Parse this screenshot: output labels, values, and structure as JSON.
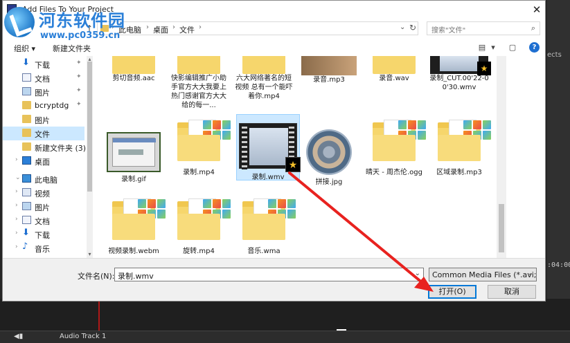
{
  "window": {
    "title": "Add Files To Your Project",
    "close_glyph": "✕"
  },
  "watermark": {
    "title": "河东软件园",
    "url": "www.pc0359.cn"
  },
  "address": {
    "up_glyph": "↑",
    "crumbs": [
      "此电脑",
      "桌面",
      "文件"
    ],
    "search_placeholder": "搜索\"文件\""
  },
  "toolbar": {
    "organize": "组织 ▾",
    "new_folder": "新建文件夹",
    "help": "?"
  },
  "sidebar": {
    "items": [
      {
        "label": "下载",
        "icon": "download-icon",
        "pinned": true
      },
      {
        "label": "文档",
        "icon": "document-icon",
        "pinned": true
      },
      {
        "label": "图片",
        "icon": "picture-icon",
        "pinned": true
      },
      {
        "label": "bcryptdg",
        "icon": "folder-icon",
        "pinned": true
      },
      {
        "label": "图片",
        "icon": "folder-icon",
        "pinned": false
      },
      {
        "label": "文件",
        "icon": "folder-icon",
        "pinned": false,
        "selected": true
      },
      {
        "label": "新建文件夹 (3)",
        "icon": "folder-icon",
        "pinned": false
      },
      {
        "label": "桌面",
        "icon": "desktop-icon",
        "pinned": false
      },
      {
        "label": "此电脑",
        "icon": "pc-icon",
        "pinned": false
      },
      {
        "label": "视频",
        "icon": "video-icon",
        "pinned": false
      },
      {
        "label": "图片",
        "icon": "picture-icon",
        "pinned": false
      },
      {
        "label": "文档",
        "icon": "document-icon",
        "pinned": false
      },
      {
        "label": "下载",
        "icon": "download-icon",
        "pinned": false
      },
      {
        "label": "音乐",
        "icon": "music-icon",
        "pinned": false
      }
    ]
  },
  "files": {
    "row1": [
      {
        "name": "剪切音频.aac",
        "icon": "folder"
      },
      {
        "name": "快影编辑推广小助手官方大大我要上热门感谢官方大大给的每一...",
        "icon": "folder"
      },
      {
        "name": "六大网络著名的短视频 总有一个能吓着你.mp4",
        "icon": "folder"
      },
      {
        "name": "录音.mp3",
        "icon": "image"
      },
      {
        "name": "录音.wav",
        "icon": "folder"
      },
      {
        "name": "录制_CUT.00'22-00'30.wmv",
        "icon": "video"
      }
    ],
    "row2": [
      {
        "name": "录制.gif",
        "icon": "gif"
      },
      {
        "name": "录制.mp4",
        "icon": "folder"
      },
      {
        "name": "录制.wmv",
        "icon": "video",
        "selected": true
      },
      {
        "name": "拼接.jpg",
        "icon": "jpg"
      },
      {
        "name": "晴天 - 周杰伦.ogg",
        "icon": "folder"
      },
      {
        "name": "区域录制.mp3",
        "icon": "folder"
      }
    ],
    "row3": [
      {
        "name": "视频录制.webm",
        "icon": "folder"
      },
      {
        "name": "旋转.mp4",
        "icon": "folder"
      },
      {
        "name": "音乐.wma",
        "icon": "folder"
      }
    ]
  },
  "footer": {
    "filename_label": "文件名(N):",
    "filename_value": "录制.wmv",
    "filetype": "Common Media Files (*.avi;*",
    "open": "打开(O)",
    "cancel": "取消"
  },
  "background": {
    "right_text": "ects",
    "timecode": ":04:00.",
    "track_label": "Audio Track 1"
  },
  "colors": {
    "accent": "#0078d7",
    "selection": "#cce8ff",
    "arrow": "#e8221f"
  }
}
